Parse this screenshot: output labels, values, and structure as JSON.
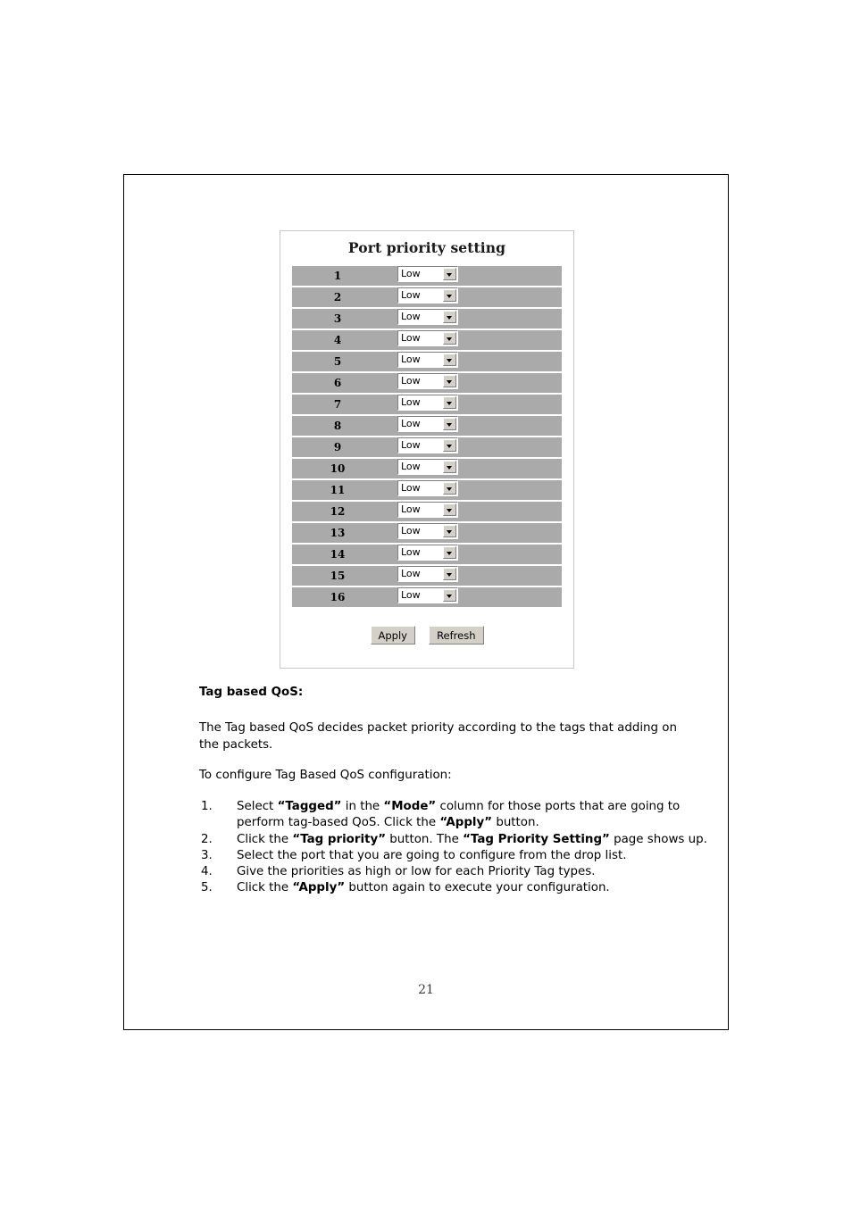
{
  "panel": {
    "title": "Port priority setting",
    "ports": [
      {
        "port": "1",
        "priority": "Low"
      },
      {
        "port": "2",
        "priority": "Low"
      },
      {
        "port": "3",
        "priority": "Low"
      },
      {
        "port": "4",
        "priority": "Low"
      },
      {
        "port": "5",
        "priority": "Low"
      },
      {
        "port": "6",
        "priority": "Low"
      },
      {
        "port": "7",
        "priority": "Low"
      },
      {
        "port": "8",
        "priority": "Low"
      },
      {
        "port": "9",
        "priority": "Low"
      },
      {
        "port": "10",
        "priority": "Low"
      },
      {
        "port": "11",
        "priority": "Low"
      },
      {
        "port": "12",
        "priority": "Low"
      },
      {
        "port": "13",
        "priority": "Low"
      },
      {
        "port": "14",
        "priority": "Low"
      },
      {
        "port": "15",
        "priority": "Low"
      },
      {
        "port": "16",
        "priority": "Low"
      }
    ],
    "buttons": {
      "apply": "Apply",
      "refresh": "Refresh"
    }
  },
  "document": {
    "heading": "Tag based QoS:",
    "intro": "The Tag based QoS decides packet priority according to the tags that adding on the packets.",
    "configure_lead": "To configure Tag Based QoS configuration:",
    "steps": [
      {
        "num": "1.",
        "html": "Select <b>“Tagged”</b> in the <b>“Mode”</b> column for those ports that are going to perform tag-based QoS. Click the <b>“Apply”</b> button."
      },
      {
        "num": "2.",
        "html": "Click the <b>“Tag priority”</b> button. The <b>“Tag Priority Setting”</b> page shows up."
      },
      {
        "num": "3.",
        "html": "Select the port that you are going to configure from the drop list."
      },
      {
        "num": "4.",
        "html": "Give the priorities as high or low for each Priority Tag types."
      },
      {
        "num": "5.",
        "html": "Click the <b>“Apply”</b> button again to execute your configuration."
      }
    ],
    "page_number": "21"
  },
  "colors": {
    "row_gray": "#aaaaaa",
    "button_face": "#d4d0c8",
    "panel_border": "#c8c8c4",
    "page_border": "#000000"
  }
}
